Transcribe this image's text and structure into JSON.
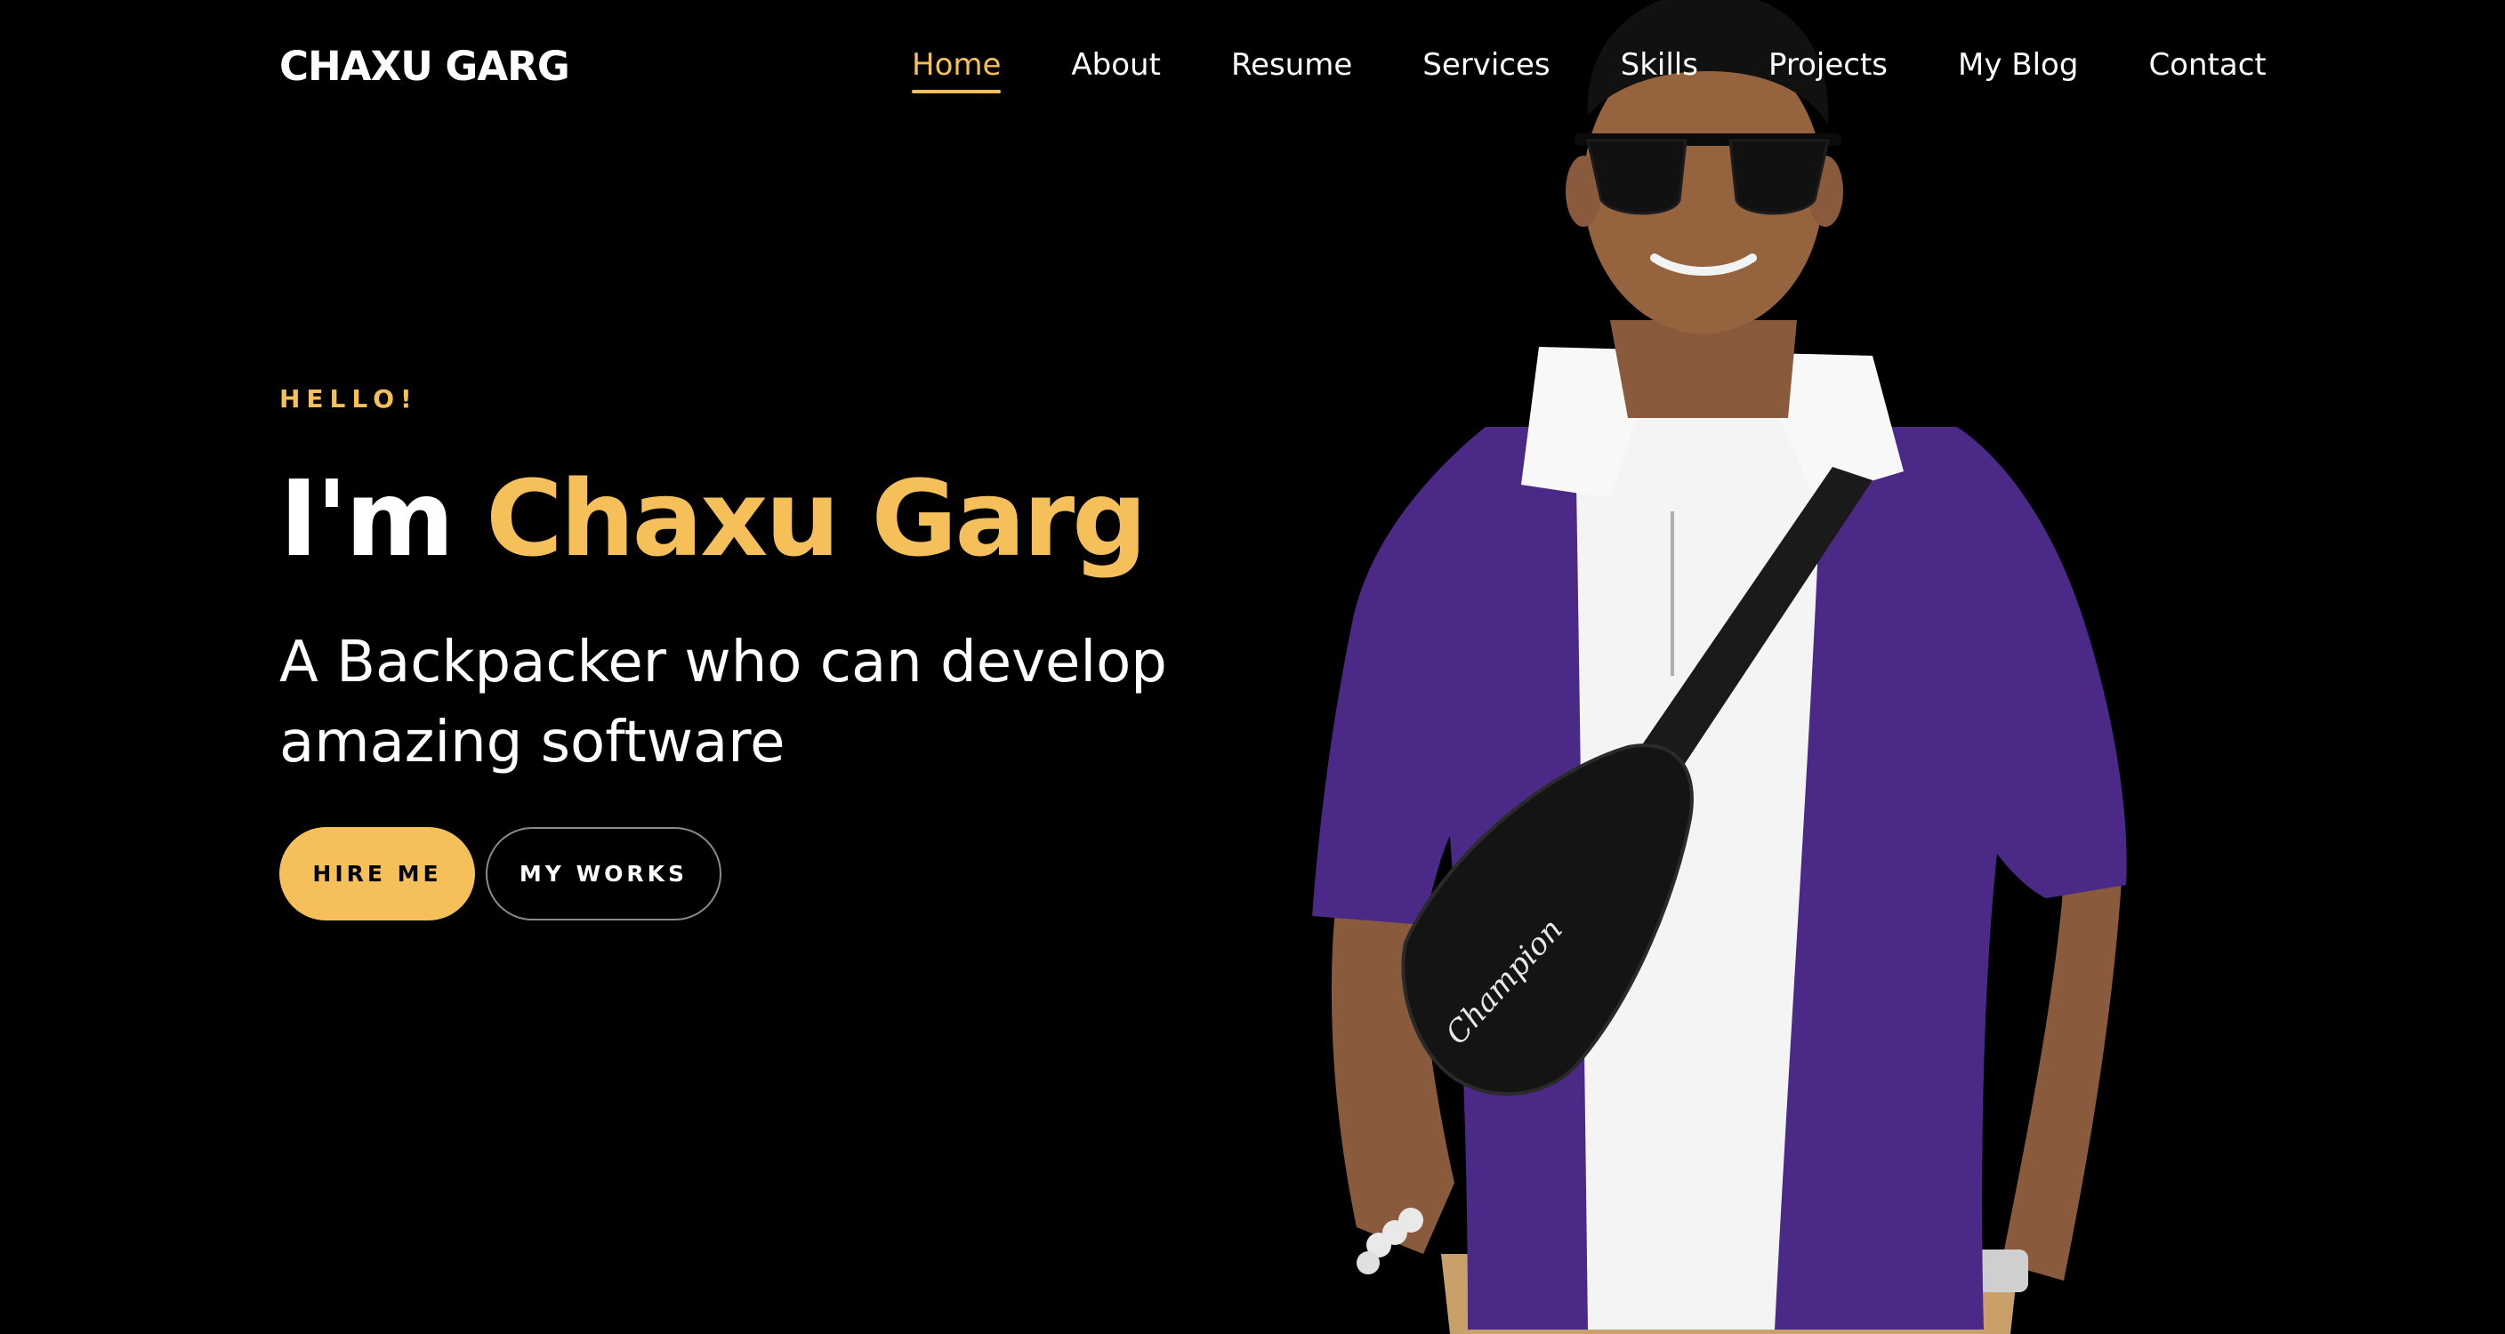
{
  "brand": "CHAXU GARG",
  "nav": {
    "items": [
      {
        "label": "Home",
        "active": true
      },
      {
        "label": "About"
      },
      {
        "label": "Resume"
      },
      {
        "label": "Services"
      },
      {
        "label": "Skills"
      },
      {
        "label": "Projects"
      },
      {
        "label": "My Blog"
      },
      {
        "label": "Contact"
      }
    ]
  },
  "hero": {
    "greeting": "HELLO!",
    "headline_prefix": "I'm ",
    "headline_name": "Chaxu Garg",
    "tagline": "A Backpacker who can develop amazing software",
    "hire_button": "HIRE ME",
    "works_button": "MY WORKS",
    "portrait_brand_text": "Champion"
  },
  "colors": {
    "accent": "#f5c05a",
    "background": "#000000",
    "shirt": "#4a2a86"
  }
}
